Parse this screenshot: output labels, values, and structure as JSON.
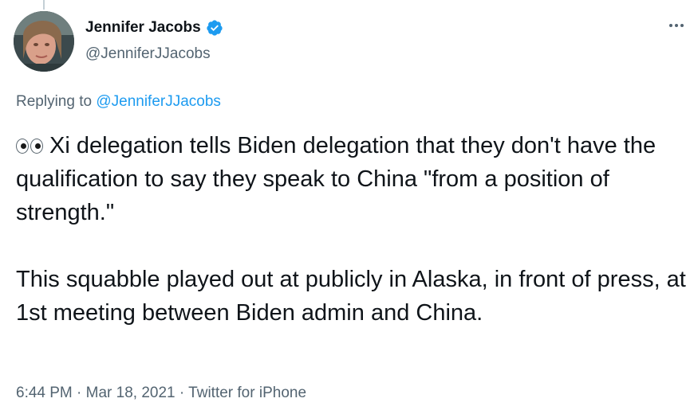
{
  "author": {
    "display_name": "Jennifer Jacobs",
    "handle": "@JenniferJJacobs",
    "verified_icon": "verified-badge-icon",
    "avatar_icon": "avatar"
  },
  "reply": {
    "prefix": "Replying to ",
    "mention": "@JenniferJJacobs"
  },
  "tweet": {
    "emoji": "eyes-emoji",
    "paragraph1": "Xi delegation tells Biden delegation that they don't have the qualification to say they speak to China \"from a position of strength.\"",
    "paragraph2": "This squabble played out at publicly in Alaska, in front of press, at 1st meeting between Biden admin and China."
  },
  "meta": {
    "time": "6:44 PM",
    "sep1": " · ",
    "date": "Mar 18, 2021",
    "sep2": " · ",
    "source": "Twitter for iPhone"
  },
  "colors": {
    "accent": "#1d9bf0",
    "secondary_text": "#536471",
    "primary_text": "#0f1419"
  }
}
